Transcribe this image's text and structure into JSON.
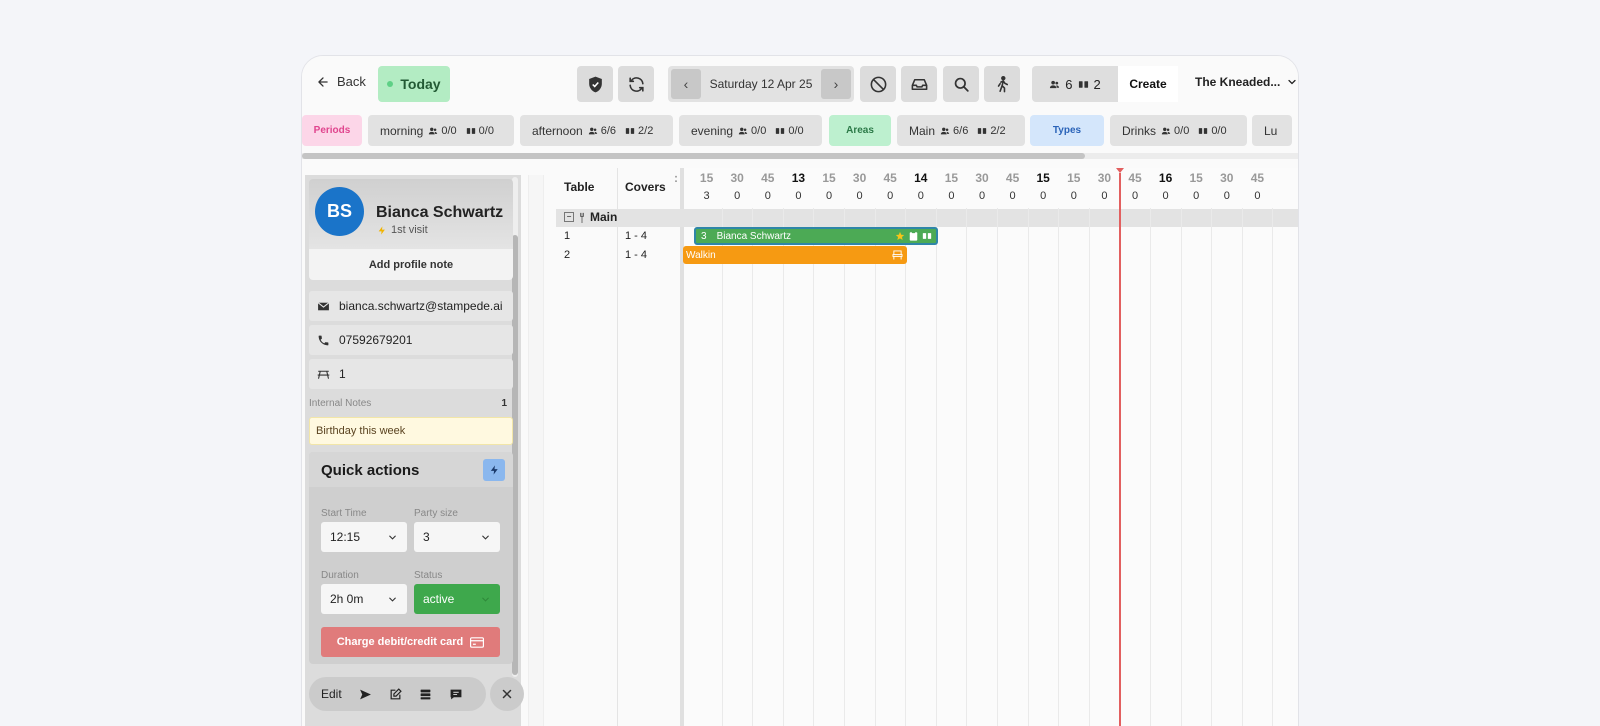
{
  "topbar": {
    "back_label": "Back",
    "today_label": "Today",
    "date_label": "Saturday 12 Apr 25",
    "prev_label": "‹",
    "next_label": "›",
    "covers_count": "6",
    "tables_count": "2",
    "create_label": "Create",
    "venue_label": "The Kneaded..."
  },
  "chips": [
    {
      "label": "Periods",
      "kind": "label",
      "bg": "#fcd6e8",
      "fg": "#e0458e"
    },
    {
      "label": "morning",
      "covers": "0/0",
      "tables": "0/0"
    },
    {
      "label": "afternoon",
      "covers": "6/6",
      "tables": "2/2"
    },
    {
      "label": "evening",
      "covers": "0/0",
      "tables": "0/0"
    },
    {
      "label": "Areas",
      "kind": "label",
      "bg": "#bdf0cf",
      "fg": "#2c7a48"
    },
    {
      "label": "Main",
      "covers": "6/6",
      "tables": "2/2"
    },
    {
      "label": "Types",
      "kind": "label",
      "bg": "#d4e6fb",
      "fg": "#2a63b8"
    },
    {
      "label": "Drinks",
      "covers": "0/0",
      "tables": "0/0"
    },
    {
      "label": "Lu"
    }
  ],
  "guest": {
    "initials": "BS",
    "name": "Bianca Schwartz",
    "visit": "1st visit",
    "add_note": "Add profile note",
    "email": "bianca.schwartz@stampede.ai",
    "phone": "07592679201",
    "table": "1",
    "internal_notes_label": "Internal Notes",
    "internal_notes_count": "1",
    "note_text": "Birthday this week",
    "quick_actions_title": "Quick actions",
    "start_time_label": "Start Time",
    "start_time": "12:15",
    "party_size_label": "Party size",
    "party_size": "3",
    "duration_label": "Duration",
    "duration": "2h 0m",
    "status_label": "Status",
    "status": "active",
    "charge_label": "Charge debit/credit card",
    "edit_label": "Edit"
  },
  "timeline": {
    "table_header": "Table",
    "covers_header": "Covers",
    "ticks": [
      {
        "label": ":",
        "count": "",
        "hour": false
      },
      {
        "label": "15",
        "count": "3",
        "hour": false
      },
      {
        "label": "30",
        "count": "0",
        "hour": false
      },
      {
        "label": "45",
        "count": "0",
        "hour": false
      },
      {
        "label": "13",
        "count": "0",
        "hour": true
      },
      {
        "label": "15",
        "count": "0",
        "hour": false
      },
      {
        "label": "30",
        "count": "0",
        "hour": false
      },
      {
        "label": "45",
        "count": "0",
        "hour": false
      },
      {
        "label": "14",
        "count": "0",
        "hour": true
      },
      {
        "label": "15",
        "count": "0",
        "hour": false
      },
      {
        "label": "30",
        "count": "0",
        "hour": false
      },
      {
        "label": "45",
        "count": "0",
        "hour": false
      },
      {
        "label": "15",
        "count": "0",
        "hour": true
      },
      {
        "label": "15",
        "count": "0",
        "hour": false
      },
      {
        "label": "30",
        "count": "0",
        "hour": false
      },
      {
        "label": "45",
        "count": "0",
        "hour": false
      },
      {
        "label": "16",
        "count": "0",
        "hour": true
      },
      {
        "label": "15",
        "count": "0",
        "hour": false
      },
      {
        "label": "30",
        "count": "0",
        "hour": false
      },
      {
        "label": "45",
        "count": "0",
        "hour": false
      }
    ],
    "area_name": "Main",
    "rows": [
      {
        "table": "1",
        "covers": "1 - 4"
      },
      {
        "table": "2",
        "covers": "1 - 4"
      }
    ],
    "bookings": [
      {
        "party": "3",
        "name": "Bianca Schwartz",
        "color": "green"
      },
      {
        "name": "Walkin",
        "color": "orange"
      }
    ]
  }
}
